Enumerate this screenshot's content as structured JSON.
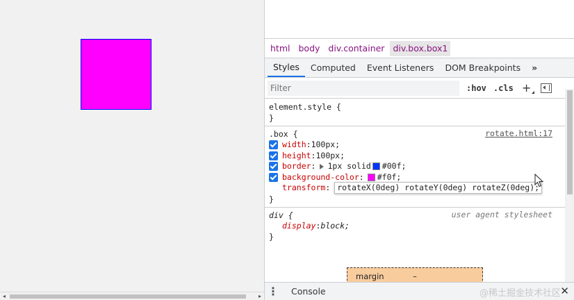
{
  "page": {
    "box_background": "#f0f",
    "box_border": "#00f",
    "scroll_left": "◂",
    "scroll_right": "▸"
  },
  "devtools": {
    "breadcrumbs": [
      "html",
      "body",
      "div.container",
      "div.box.box1"
    ],
    "tabs": [
      "Styles",
      "Computed",
      "Event Listeners",
      "DOM Breakpoints",
      "»"
    ],
    "filter_placeholder": "Filter",
    "hov": ":hov",
    "cls": ".cls",
    "plus": "+",
    "rules": {
      "element_style": {
        "selector": "element.style {",
        "close": "}"
      },
      "box": {
        "selector": ".box {",
        "source": "rotate.html:17",
        "width": {
          "name": "width",
          "value": "100px;"
        },
        "height": {
          "name": "height",
          "value": "100px;"
        },
        "border": {
          "name": "border",
          "value": "1px solid ",
          "color_text": "#00f;",
          "swatch": "#0000ff"
        },
        "background": {
          "name": "background-color",
          "color_text": "#f0f;",
          "swatch": "#ff00ff"
        },
        "transform": {
          "name": "transform",
          "value": "rotateX(0deg) rotateY(0deg)  rotateZ(0deg);"
        },
        "close": "}"
      },
      "div": {
        "selector": "div {",
        "source": "user agent stylesheet",
        "display": {
          "name": "display",
          "value": "block;"
        },
        "close": "}"
      }
    },
    "box_model": {
      "label": "margin",
      "value": "–"
    },
    "drawer": {
      "menu": "⋮",
      "console": "Console",
      "watermark": "@稀土掘金技术社区",
      "close": "✕"
    }
  }
}
